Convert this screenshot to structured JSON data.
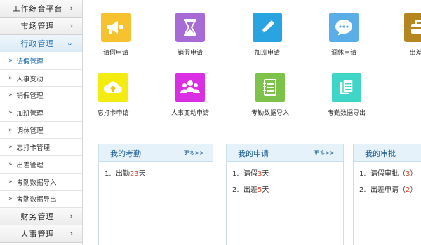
{
  "sidebar": {
    "groups": [
      {
        "label": "工作综合平台",
        "chevron": "›"
      },
      {
        "label": "市场管理",
        "chevron": "›"
      },
      {
        "label": "行政管理",
        "chevron": "⌄"
      }
    ],
    "sub_items": [
      {
        "label": "请假管理"
      },
      {
        "label": "人事变动"
      },
      {
        "label": "销假管理"
      },
      {
        "label": "加班管理"
      },
      {
        "label": "调休管理"
      },
      {
        "label": "忘打卡管理"
      },
      {
        "label": "出差管理"
      },
      {
        "label": "考勤数据导入"
      },
      {
        "label": "考勤数据导出"
      }
    ],
    "bottom_groups": [
      {
        "label": "财务管理",
        "chevron": "›"
      },
      {
        "label": "人事管理",
        "chevron": "›"
      }
    ],
    "marker": "»"
  },
  "tiles": [
    {
      "label": "请假申请",
      "icon": "megaphone-icon",
      "color": "#f7c230"
    },
    {
      "label": "销假申请",
      "icon": "hourglass-icon",
      "color": "#a86bd6"
    },
    {
      "label": "加班申请",
      "icon": "pencil-icon",
      "color": "#2aa3e1"
    },
    {
      "label": "调休申请",
      "icon": "chat-bubble-icon",
      "color": "#5aaee8"
    },
    {
      "label": "出差申",
      "icon": "briefcase-icon",
      "color": "#b5861f"
    },
    {
      "label": "忘打卡申请",
      "icon": "cloud-upload-icon",
      "color": "#f4ec10"
    },
    {
      "label": "人事变动申请",
      "icon": "people-icon",
      "color": "#d92ee1"
    },
    {
      "label": "考勤数据导入",
      "icon": "notebook-icon",
      "color": "#7dc24a"
    },
    {
      "label": "考勤数据导出",
      "icon": "documents-icon",
      "color": "#3fd6c8"
    }
  ],
  "panels": {
    "attendance": {
      "title": "我的考勤",
      "more": "更多>>",
      "rows": [
        {
          "num": "1.",
          "pre": "出勤",
          "val": "23",
          "post": "天"
        }
      ]
    },
    "requests": {
      "title": "我的申请",
      "more": "更多>>",
      "rows": [
        {
          "num": "1.",
          "pre": "请假",
          "val": "3",
          "post": "天"
        },
        {
          "num": "2.",
          "pre": "出差",
          "val": "5",
          "post": "天"
        }
      ]
    },
    "approvals": {
      "title": "我的审批",
      "rows": [
        {
          "num": "1.",
          "pre": "请假审批（",
          "val": "3",
          "post": "）"
        },
        {
          "num": "2.",
          "pre": "出差申请（",
          "val": "2",
          "post": "）"
        }
      ]
    }
  }
}
